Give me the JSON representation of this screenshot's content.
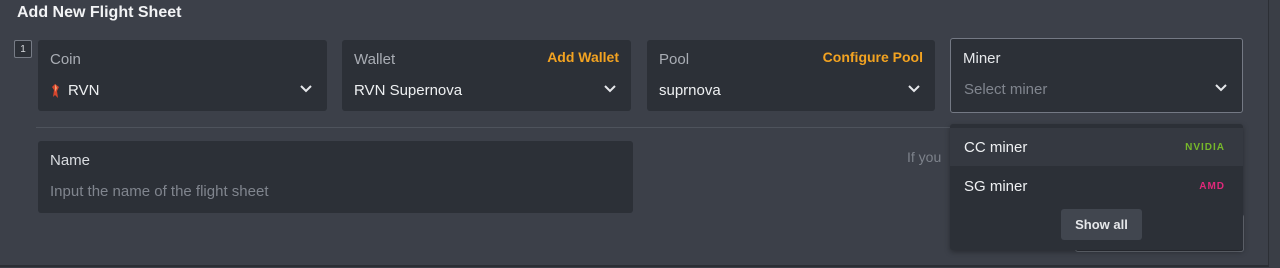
{
  "title": "Add New Flight Sheet",
  "row_number": "1",
  "coin": {
    "label": "Coin",
    "value": "RVN",
    "icon": "ravencoin-icon",
    "icon_color": "#d6462d"
  },
  "wallet": {
    "label": "Wallet",
    "action": "Add Wallet",
    "value": "RVN Supernova"
  },
  "pool": {
    "label": "Pool",
    "action": "Configure Pool",
    "value": "suprnova"
  },
  "miner": {
    "label": "Miner",
    "placeholder": "Select miner"
  },
  "name_field": {
    "label": "Name",
    "placeholder": "Input the name of the flight sheet"
  },
  "hint_text": "If you",
  "dropdown": {
    "options": [
      {
        "name": "CC miner",
        "tag": "NVIDIA",
        "tag_color": "#76b82a"
      },
      {
        "name": "SG miner",
        "tag": "AMD",
        "tag_color": "#e0287a"
      }
    ],
    "show_all": "Show all"
  },
  "colors": {
    "accent": "#f3a321"
  }
}
